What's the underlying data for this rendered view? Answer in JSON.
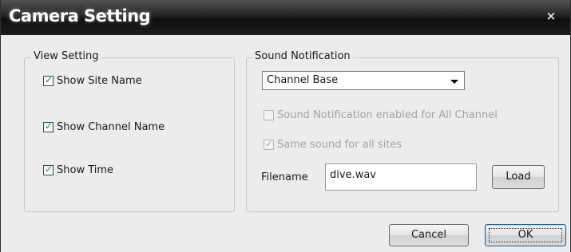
{
  "window": {
    "title": "Camera Setting",
    "close_glyph": "×"
  },
  "view_setting": {
    "legend": "View Setting",
    "items": [
      {
        "label": "Show Site Name",
        "checked": true
      },
      {
        "label": "Show Channel Name",
        "checked": true
      },
      {
        "label": "Show Time",
        "checked": true
      }
    ]
  },
  "sound_notification": {
    "legend": "Sound Notification",
    "mode_selected": "Channel Base",
    "all_channel_label": "Sound Notification enabled for All Channel",
    "all_channel_checked": false,
    "all_channel_disabled": true,
    "same_sound_label": "Same sound for all sites",
    "same_sound_checked": true,
    "same_sound_disabled": true,
    "filename_label": "Filename",
    "filename_value": "dive.wav",
    "load_label": "Load"
  },
  "buttons": {
    "cancel": "Cancel",
    "ok": "OK"
  },
  "colors": {
    "title_bar": "#1a1a1a",
    "dialog_bg": "#ececec",
    "check_mark": "#21a121",
    "disabled_text": "#a3a3a3"
  }
}
